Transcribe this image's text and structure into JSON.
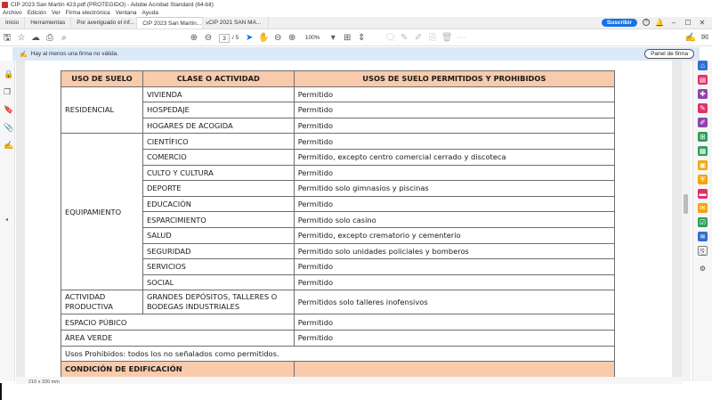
{
  "window": {
    "title": "CIP 2023 San Martín 423.pdf (PROTEGIDO) - Adobe Acrobat Standard (64-bit)"
  },
  "menu": [
    "Archivo",
    "Edición",
    "Ver",
    "Firma electrónica",
    "Ventana",
    "Ayuda"
  ],
  "tabs": {
    "home": "Inicio",
    "tools": "Herramientas",
    "doc1": "Por averiguado el inf...",
    "doc2": "CIP 2023 San Martín...",
    "doc3": "CIP 2021 SAN MA..."
  },
  "header_right": {
    "subscribe": "Suscribir"
  },
  "toolbar": {
    "page_current": "3",
    "page_total": "/ 5",
    "zoom": "100%"
  },
  "signature_bar": {
    "message": "Hay al menos una firma no válida.",
    "panel_button": "Panel de firma"
  },
  "table": {
    "headers": [
      "USO DE SUELO",
      "CLASE O ACTIVIDAD",
      "USOS DE SUELO PERMITIDOS Y PROHIBIDOS"
    ],
    "groups": [
      {
        "category": "RESIDENCIAL",
        "rows": [
          {
            "activity": "VIVIENDA",
            "use": "Permitido"
          },
          {
            "activity": "HOSPEDAJE",
            "use": "Permitido"
          },
          {
            "activity": "HOGARES DE ACOGIDA",
            "use": "Permitido"
          }
        ]
      },
      {
        "category": "EQUIPAMIENTO",
        "rows": [
          {
            "activity": "CIENTÍFICO",
            "use": "Permitido"
          },
          {
            "activity": "COMERCIO",
            "use": "Permitido, excepto centro comercial cerrado y discoteca"
          },
          {
            "activity": "CULTO Y CULTURA",
            "use": "Permitido"
          },
          {
            "activity": "DEPORTE",
            "use": "Permitido solo gimnasios y piscinas"
          },
          {
            "activity": "EDUCACIÓN",
            "use": "Permitido"
          },
          {
            "activity": "ESPARCIMIENTO",
            "use": "Permitido solo casino"
          },
          {
            "activity": "SALUD",
            "use": "Permitido, excepto crematorio y cementerio"
          },
          {
            "activity": "SEGURIDAD",
            "use": "Permitido solo unidades policiales y bomberos"
          },
          {
            "activity": "SERVICIOS",
            "use": "Permitido"
          },
          {
            "activity": "SOCIAL",
            "use": "Permitido"
          }
        ]
      },
      {
        "category": "ACTIVIDAD PRODUCTIVA",
        "rows": [
          {
            "activity": "GRANDES DEPÓSITOS, TALLERES O BODEGAS INDUSTRIALES",
            "use": "Permitidos solo talleres inofensivos"
          }
        ]
      }
    ],
    "single_rows": [
      {
        "category": "ESPACIO PÚBICO",
        "use": "Permitido"
      },
      {
        "category": "ÁREA VERDE",
        "use": "Permitido"
      }
    ],
    "footnote": "Usos Prohibidos: todos los no señalados como permitidos.",
    "next_section": "CONDICIÓN DE EDIFICACIÓN"
  },
  "status": {
    "page_size": "216 x 330 mm"
  },
  "colors": {
    "accent": "#1473e6",
    "table_header": "#f7cbac",
    "signature_bar": "#dbe9f8"
  }
}
